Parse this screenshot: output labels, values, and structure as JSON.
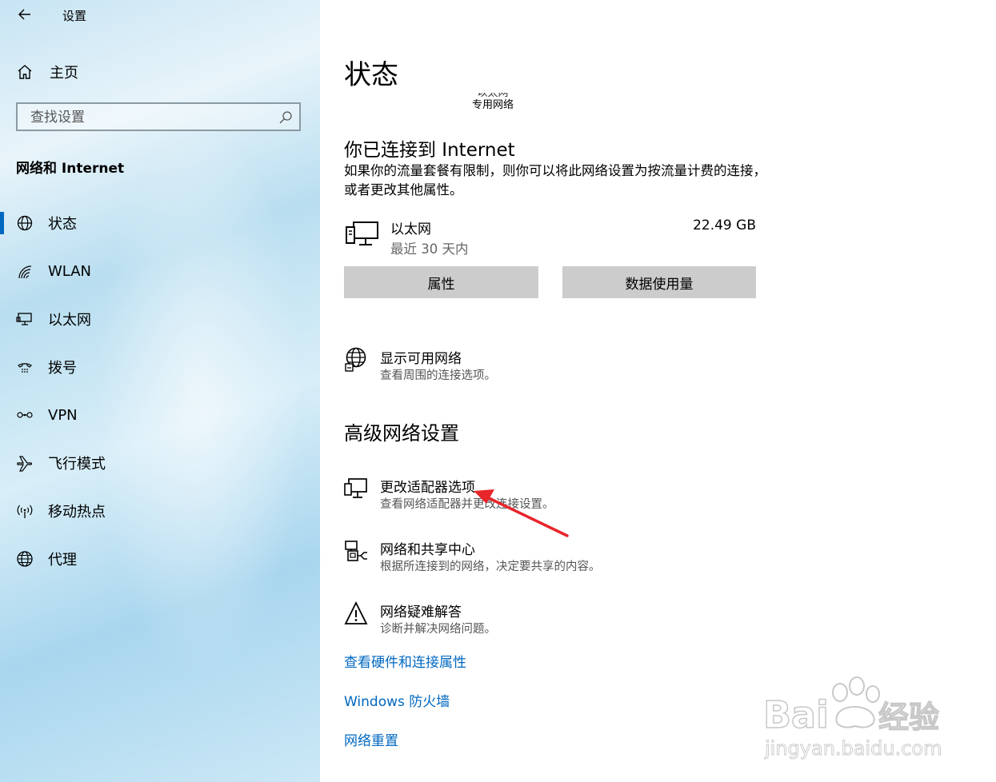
{
  "app": {
    "title": "设置"
  },
  "sidebar": {
    "home_label": "主页",
    "search_placeholder": "查找设置",
    "section_title": "网络和 Internet",
    "items": [
      {
        "label": "状态",
        "icon": "globe-status-icon",
        "active": true
      },
      {
        "label": "WLAN",
        "icon": "wifi-icon"
      },
      {
        "label": "以太网",
        "icon": "ethernet-icon"
      },
      {
        "label": "拨号",
        "icon": "dialup-icon"
      },
      {
        "label": "VPN",
        "icon": "vpn-icon"
      },
      {
        "label": "飞行模式",
        "icon": "airplane-icon"
      },
      {
        "label": "移动热点",
        "icon": "hotspot-icon"
      },
      {
        "label": "代理",
        "icon": "globe-icon"
      }
    ]
  },
  "main": {
    "title": "状态",
    "network_diagram": {
      "caption_cut": "以太网",
      "caption": "专用网络"
    },
    "connected_title": "你已连接到 Internet",
    "connected_desc": "如果你的流量套餐有限制，则你可以将此网络设置为按流量计费的连接，或者更改其他属性。",
    "ethernet": {
      "name": "以太网",
      "period": "最近 30 天内",
      "usage": "22.49 GB"
    },
    "buttons": {
      "properties": "属性",
      "data_usage": "数据使用量"
    },
    "show_networks": {
      "title": "显示可用网络",
      "desc": "查看周围的连接选项。"
    },
    "advanced_title": "高级网络设置",
    "advanced_options": [
      {
        "title": "更改适配器选项",
        "desc": "查看网络适配器并更改连接设置。"
      },
      {
        "title": "网络和共享中心",
        "desc": "根据所连接到的网络，决定要共享的内容。"
      },
      {
        "title": "网络疑难解答",
        "desc": "诊断并解决网络问题。"
      }
    ],
    "links": [
      "查看硬件和连接属性",
      "Windows 防火墙",
      "网络重置"
    ]
  },
  "colors": {
    "accent": "#0067c0",
    "annotation_arrow": "#e8252b",
    "button_bg": "#cccccc"
  },
  "watermark": {
    "brand": "Baidu经验",
    "url": "jingyan.baidu.com"
  }
}
